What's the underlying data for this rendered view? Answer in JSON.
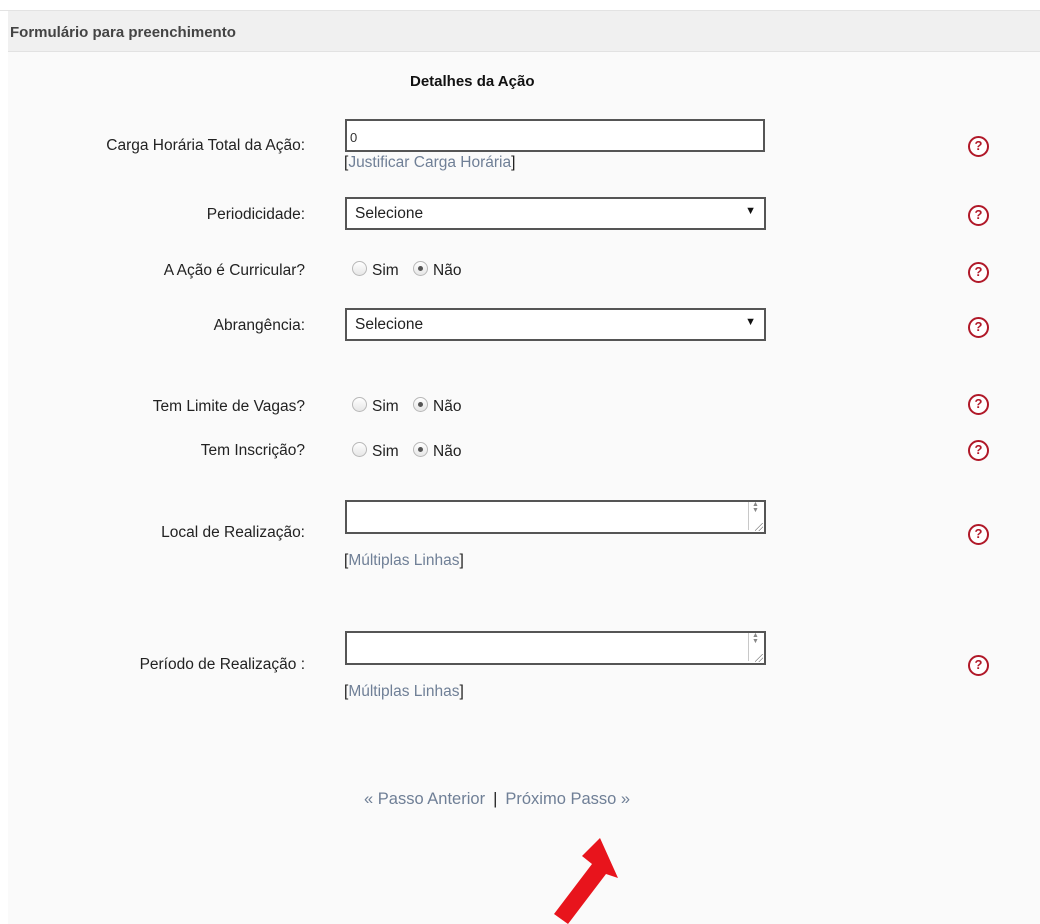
{
  "panel": {
    "title": "Formulário para preenchimento"
  },
  "section": {
    "title": "Detalhes da Ação"
  },
  "fields": {
    "carga_horaria": {
      "label": "Carga Horária Total da Ação:",
      "value": "0",
      "link_prefix": "[",
      "link": "Justificar Carga Horária",
      "link_suffix": "]"
    },
    "periodicidade": {
      "label": "Periodicidade:",
      "value": "Selecione"
    },
    "curricular": {
      "label": "A Ação é Curricular?",
      "opt_yes": "Sim",
      "opt_no": "Não",
      "selected": "Não"
    },
    "abrangencia": {
      "label": "Abrangência:",
      "value": "Selecione"
    },
    "limite_vagas": {
      "label": "Tem Limite de Vagas?",
      "opt_yes": "Sim",
      "opt_no": "Não",
      "selected": "Não"
    },
    "inscricao": {
      "label": "Tem Inscrição?",
      "opt_yes": "Sim",
      "opt_no": "Não",
      "selected": "Não"
    },
    "local": {
      "label": "Local de Realização:",
      "value": "",
      "link_prefix": "[",
      "link": "Múltiplas Linhas",
      "link_suffix": "]"
    },
    "periodo": {
      "label": "Período de Realização :",
      "value": "",
      "link_prefix": "[",
      "link": "Múltiplas Linhas",
      "link_suffix": "]"
    }
  },
  "help_icon": "?",
  "navigation": {
    "previous": "« Passo Anterior",
    "separator": "|",
    "next": "Próximo Passo »"
  },
  "colors": {
    "help": "#b01828",
    "link": "#6f7f96",
    "arrow": "#e8141c"
  },
  "icons": {
    "help": "question-circle-icon",
    "dropdown": "triangle-down-icon",
    "pointer": "red-arrow-icon"
  }
}
